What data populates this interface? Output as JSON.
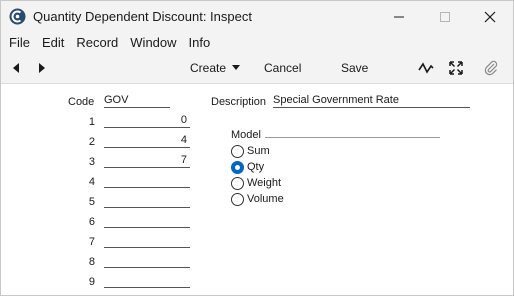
{
  "window": {
    "title": "Quantity Dependent Discount: Inspect"
  },
  "menu": [
    "File",
    "Edit",
    "Record",
    "Window",
    "Info"
  ],
  "toolbar": {
    "create_label": "Create",
    "cancel_label": "Cancel",
    "save_label": "Save"
  },
  "form": {
    "code_label": "Code",
    "code_value": "GOV",
    "description_label": "Description",
    "description_value": "Special Government Rate",
    "rows": [
      {
        "num": "1",
        "value": "0"
      },
      {
        "num": "2",
        "value": "4"
      },
      {
        "num": "3",
        "value": "7"
      },
      {
        "num": "4",
        "value": ""
      },
      {
        "num": "5",
        "value": ""
      },
      {
        "num": "6",
        "value": ""
      },
      {
        "num": "7",
        "value": ""
      },
      {
        "num": "8",
        "value": ""
      },
      {
        "num": "9",
        "value": ""
      }
    ],
    "model_label": "Model",
    "model_options": [
      {
        "label": "Sum",
        "selected": false
      },
      {
        "label": "Qty",
        "selected": true
      },
      {
        "label": "Weight",
        "selected": false
      },
      {
        "label": "Volume",
        "selected": false
      }
    ]
  },
  "colors": {
    "accent": "#0067c0",
    "chrome": "#f3f3f3"
  },
  "icons": [
    "app-logo-icon",
    "minimize-icon",
    "maximize-icon",
    "close-icon",
    "nav-back-icon",
    "nav-forward-icon",
    "chevron-down-icon",
    "activity-icon",
    "expand-icon",
    "paperclip-icon"
  ]
}
